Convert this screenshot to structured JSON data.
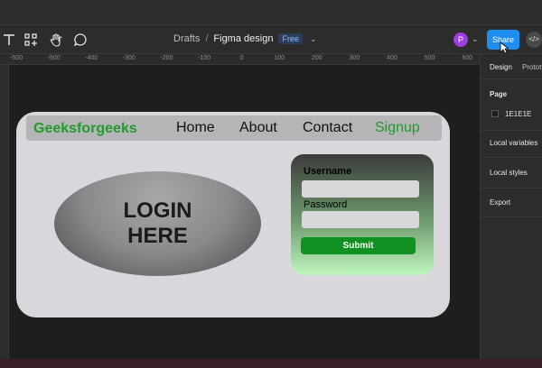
{
  "toolbar": {
    "breadcrumb_parent": "Drafts",
    "breadcrumb_sep": "/",
    "file_name": "Figma design",
    "plan_badge": "Free",
    "avatar_initial": "P",
    "share_label": "Share",
    "dev_mode_label": "</>"
  },
  "ruler": {
    "h_ticks": [
      "-600",
      "-500",
      "-400",
      "-300",
      "-200",
      "-100",
      "0",
      "100",
      "200",
      "300",
      "400",
      "500",
      "600"
    ]
  },
  "design": {
    "brand": "Geeksforgeeks",
    "nav": [
      "Home",
      "About",
      "Contact",
      "Signup"
    ],
    "hero_text": "LOGIN HERE",
    "username_label": "Username",
    "password_label": "Password",
    "submit_label": "Submit"
  },
  "panel": {
    "tab_design": "Design",
    "tab_prototype": "Prototype",
    "page_label": "Page",
    "page_color": "1E1E1E",
    "local_variables": "Local variables",
    "local_styles": "Local styles",
    "export": "Export"
  },
  "colors": {
    "accent": "#1d8ef0",
    "brand_green": "#1f9c2a",
    "canvas_bg": "#1e1e1e"
  }
}
